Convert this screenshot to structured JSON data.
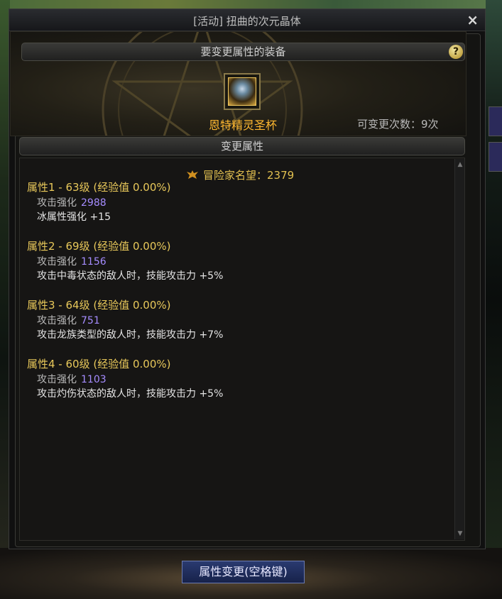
{
  "window": {
    "title": "[活动] 扭曲的次元晶体",
    "close": "×"
  },
  "equip_section": {
    "label": "要变更属性的装备",
    "help": "?"
  },
  "item": {
    "name": "恩特精灵圣杯",
    "change_count": "可变更次数：9次"
  },
  "props_section": {
    "label": "变更属性"
  },
  "fame": {
    "text": "冒险家名望：2379"
  },
  "properties": [
    {
      "header": "属性1 - 63级 (经验值 0.00%)",
      "label": "攻击强化",
      "value": "2988",
      "effect": "冰属性强化 +15"
    },
    {
      "header": "属性2 - 69级 (经验值 0.00%)",
      "label": "攻击强化",
      "value": "1156",
      "effect": "攻击中毒状态的敌人时，技能攻击力 +5%"
    },
    {
      "header": "属性3 - 64级 (经验值 0.00%)",
      "label": "攻击强化",
      "value": "751",
      "effect": "攻击龙族类型的敌人时，技能攻击力 +7%"
    },
    {
      "header": "属性4 - 60级 (经验值 0.00%)",
      "label": "攻击强化",
      "value": "1103",
      "effect": "攻击灼伤状态的敌人时，技能攻击力 +5%"
    }
  ],
  "action_button": {
    "label": "属性变更(空格键)"
  },
  "colors": {
    "gold": "#e8c85a",
    "item_orange": "#ffb830",
    "value_purple": "#a58cff",
    "button_blue": "#17224a"
  }
}
